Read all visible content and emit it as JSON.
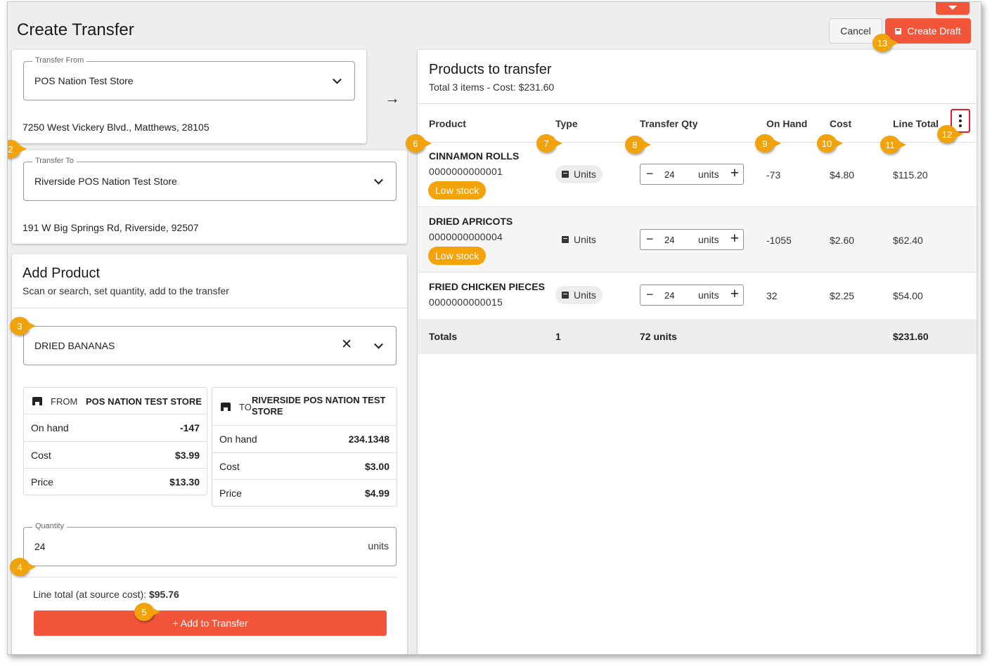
{
  "page": {
    "title": "Create Transfer",
    "cancel_label": "Cancel",
    "create_draft_label": "Create Draft"
  },
  "transfer_from": {
    "label": "Transfer From",
    "value": "POS Nation Test Store",
    "address": "7250 West Vickery Blvd., Matthews, 28105"
  },
  "transfer_to": {
    "label": "Transfer To",
    "value": "Riverside POS Nation Test Store",
    "address": "191 W Big Springs Rd, Riverside, 92507"
  },
  "add_product": {
    "title": "Add Product",
    "subtitle": "Scan or search, set quantity, add to the transfer",
    "search_value": "DRIED BANANAS",
    "from_card": {
      "direction": "FROM",
      "store": "POS NATION TEST STORE",
      "rows": [
        {
          "label": "On hand",
          "value": "-147"
        },
        {
          "label": "Cost",
          "value": "$3.99"
        },
        {
          "label": "Price",
          "value": "$13.30"
        }
      ]
    },
    "to_card": {
      "direction": "TO",
      "store": "RIVERSIDE POS NATION TEST STORE",
      "rows": [
        {
          "label": "On hand",
          "value": "234.1348"
        },
        {
          "label": "Cost",
          "value": "$3.00"
        },
        {
          "label": "Price",
          "value": "$4.99"
        }
      ]
    },
    "quantity_label": "Quantity",
    "quantity_value": "24",
    "quantity_unit": "units",
    "line_total_label": "Line total (at source cost):",
    "line_total_value": "$95.76",
    "add_button_label": "+   Add to Transfer"
  },
  "products": {
    "title": "Products to transfer",
    "summary": "Total 3 items - Cost: $231.60",
    "columns": [
      "Product",
      "Type",
      "Transfer Qty",
      "On Hand",
      "Cost",
      "Line Total"
    ],
    "rows": [
      {
        "name": "CINNAMON ROLLS",
        "sku": "0000000000001",
        "badge": "Low stock",
        "type": "Units",
        "qty": "24",
        "unit": "units",
        "on_hand": "-73",
        "cost": "$4.80",
        "line_total": "$115.20"
      },
      {
        "name": "DRIED APRICOTS",
        "sku": "0000000000004",
        "badge": "Low stock",
        "type": "Units",
        "qty": "24",
        "unit": "units",
        "on_hand": "-1055",
        "cost": "$2.60",
        "line_total": "$62.40"
      },
      {
        "name": "FRIED CHICKEN PIECES",
        "sku": "0000000000015",
        "badge": "",
        "type": "Units",
        "qty": "24",
        "unit": "units",
        "on_hand": "32",
        "cost": "$2.25",
        "line_total": "$54.00"
      }
    ],
    "totals": {
      "label": "Totals",
      "type": "1",
      "qty": "72 units",
      "line_total": "$231.60"
    }
  },
  "callouts": [
    "2",
    "3",
    "4",
    "5",
    "6",
    "7",
    "8",
    "9",
    "10",
    "11",
    "12",
    "13"
  ],
  "icons": {
    "minus": "−",
    "plus": "+",
    "clear": "✕",
    "arrow": "→"
  },
  "colors": {
    "accent": "#f2553a",
    "low_stock": "#f5a30a",
    "callout": "#f0a30b"
  }
}
